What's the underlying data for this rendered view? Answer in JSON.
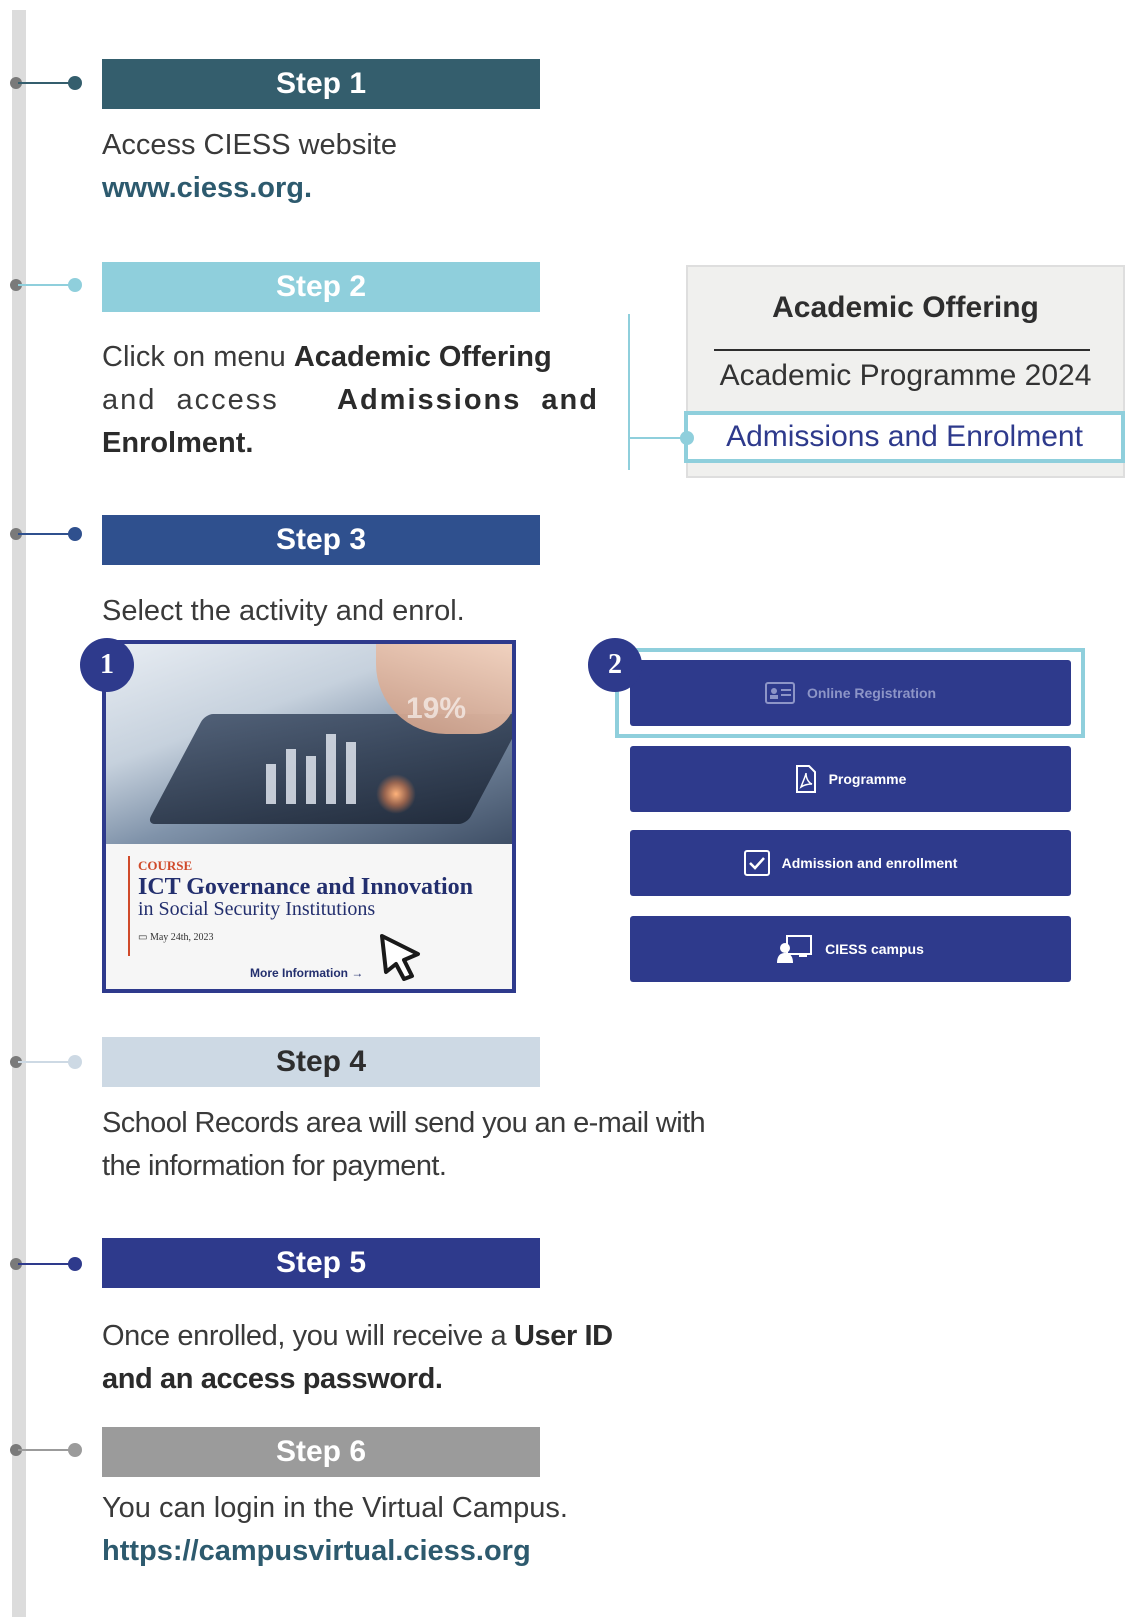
{
  "steps": [
    {
      "label": "Step 1",
      "color": "#345e6d",
      "line_color": "#345e6d",
      "dot_color": "#345e6d"
    },
    {
      "label": "Step 2",
      "color": "#8fcfdc",
      "line_color": "#8fcfdc",
      "dot_color": "#8fcfdc"
    },
    {
      "label": "Step 3",
      "color": "#2f508e",
      "line_color": "#2f508e",
      "dot_color": "#2f508e"
    },
    {
      "label": "Step 4",
      "color": "#cdd9e4",
      "line_color": "#cdd9e4",
      "dot_color": "#cdd9e4"
    },
    {
      "label": "Step 5",
      "color": "#2e3a8c",
      "line_color": "#2e3a8c",
      "dot_color": "#2e3a8c"
    },
    {
      "label": "Step 6",
      "color": "#9b9b9b",
      "line_color": "#9b9b9b",
      "dot_color": "#9b9b9b"
    }
  ],
  "step1": {
    "text": "Access CIESS website",
    "link": "www.ciess.org."
  },
  "step2": {
    "text_pre": "Click on menu ",
    "menu_bold": "Academic Offering",
    "text_mid": "and access ",
    "target_bold_1": "Admissions and",
    "target_bold_2": "Enrolment."
  },
  "menu": {
    "title": "Academic Offering",
    "item1": "Academic Programme 2024",
    "item2": "Admissions and Enrolment"
  },
  "step3": {
    "text": "Select the activity and enrol."
  },
  "course_card": {
    "badge": "1",
    "image_text": "19%",
    "tag": "COURSE",
    "title": "ICT Governance and Innovation",
    "subtitle": "in Social Security Institutions",
    "date": "May 24th, 2023",
    "more": "More Information",
    "more_arrow": "→"
  },
  "actions": {
    "badge": "2",
    "online_registration": "Online Registration",
    "programme": "Programme",
    "admission": "Admission and enrollment",
    "campus": "CIESS campus"
  },
  "step4": {
    "text_1": "School Records area will send you an e-mail with",
    "text_2": "the information for payment."
  },
  "step5": {
    "text_pre": "Once enrolled, you will receive a ",
    "bold_1": "User ID",
    "bold_2": "and an access password."
  },
  "step6": {
    "text": "You can login in the Virtual Campus.",
    "link": "https://campusvirtual.ciess.org"
  },
  "colors": {
    "accent_navy": "#2e3a8c",
    "accent_teal": "#8fcfdc",
    "link": "#2d5a6e",
    "timeline": "#dcdcdc",
    "dot_gray": "#7a7a7a"
  }
}
